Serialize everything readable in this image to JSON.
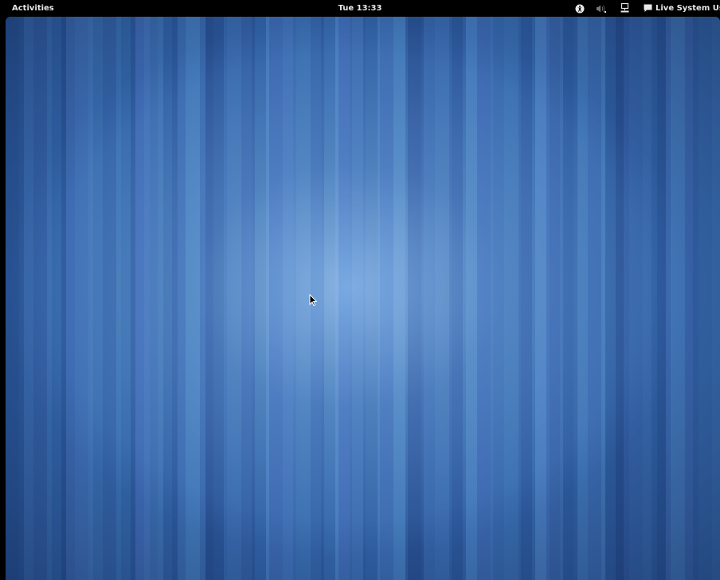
{
  "top_bar": {
    "activities_label": "Activities",
    "clock": "Tue 13:33",
    "indicators": {
      "accessibility_icon": "accessibility-icon",
      "volume_icon": "volume-icon",
      "network_icon": "network-wired-icon"
    },
    "user_menu": {
      "icon": "chat-status-icon",
      "label": "Live System User"
    }
  },
  "desktop": {
    "wallpaper": "blue-vertical-stripes",
    "colors": {
      "panel_bg": "#000000",
      "panel_text": "#e8e8e8",
      "wallpaper_dark": "#1d4481",
      "wallpaper_light": "#8cb9eb"
    }
  }
}
